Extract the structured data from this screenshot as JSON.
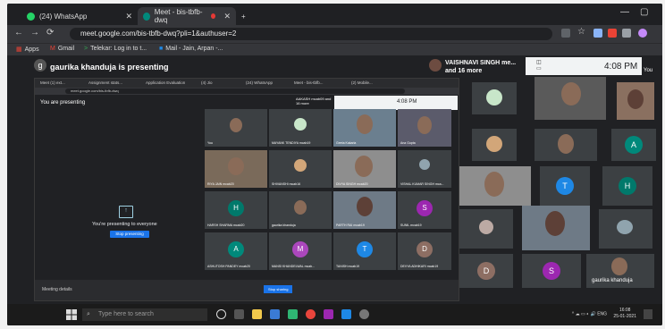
{
  "browser": {
    "tabs": [
      {
        "label": "(24) WhatsApp",
        "icon": "whatsapp-icon",
        "color": "#25d366"
      },
      {
        "label": "Meet - bis-tbfb-dwq",
        "icon": "meet-icon",
        "color": "#00897b"
      }
    ],
    "new_tab": "+",
    "url": "meet.google.com/bis-tbfb-dwq?pli=1&authuser=2",
    "bookmarks": [
      "Apps",
      "Gmail",
      "Telekar: Log in to t...",
      "Mail - Jain, Arpan -..."
    ]
  },
  "meet": {
    "presenting_text": "gaurika khanduja is presenting",
    "presenter_initial": "g",
    "top_participant": {
      "line1": "VAISHNAVI SINGH me...",
      "line2": "and 16 more"
    },
    "clock": "4:08 PM",
    "you_label": "You"
  },
  "shared": {
    "tabs": [
      "Meet (1) ext...",
      "Assignment stats...",
      "Application Evaluation",
      "(4) Jio",
      "(24) WhatsApp",
      "Meet - bis-tbfb...",
      "(2) Mobile..."
    ],
    "url": "meet.google.com/bis-tbfb-dwq",
    "you_presenting": "You are presenting",
    "presenting_everyone": "You're presenting to everyone",
    "stop_button": "Stop presenting",
    "top_participant": "AAKASH mcab09 and 16 more",
    "clock": "4:08 PM",
    "tiles": [
      {
        "name": "You"
      },
      {
        "name": "MAYANK TENDIYA mcab19"
      },
      {
        "name": "Geeta Kakarla"
      },
      {
        "name": "Ana Gupta"
      },
      {
        "name": "RIYA JAIN mcab20"
      },
      {
        "name": "SHIVANSHI mcab16"
      },
      {
        "name": "DIVYA SINGH mcab20"
      },
      {
        "name": "VISHAL KUMAR SINGH mca..."
      },
      {
        "name": "HARSH SHARMA mcab20",
        "initial": "H",
        "color": "#00796b"
      },
      {
        "name": "gaurika khanduja"
      },
      {
        "name": "PARTH RAI mcab19"
      },
      {
        "name": "SUNIL mcab19",
        "initial": "S",
        "color": "#9c27b0"
      },
      {
        "name": "ASHUTOSH PANDEY mcab20",
        "initial": "A",
        "color": "#00897b"
      },
      {
        "name": "MANSI KHANDELWAL mcab...",
        "initial": "M",
        "color": "#ab47bc"
      },
      {
        "name": "TANISH mcab19",
        "initial": "T",
        "color": "#1e88e5"
      },
      {
        "name": "DEVYA ADHIKARI mcab19",
        "initial": "D",
        "color": "#8d6e63"
      }
    ],
    "bottom_left": "Meeting details",
    "bottom_right_btn": "Stop sharing"
  },
  "outer_tiles": [
    {
      "initial": "A",
      "color": "#00897b"
    },
    {
      "initial": "T",
      "color": "#1e88e5"
    },
    {
      "initial": "H",
      "color": "#00796b"
    },
    {
      "initial": "D",
      "color": "#8d6e63"
    },
    {
      "initial": "S",
      "color": "#9c27b0"
    }
  ],
  "bottom_name": "gaurika khanduja",
  "taskbar": {
    "search_placeholder": "Type here to search",
    "language": "ENG",
    "time": "16:08",
    "date": "25-01-2021"
  }
}
